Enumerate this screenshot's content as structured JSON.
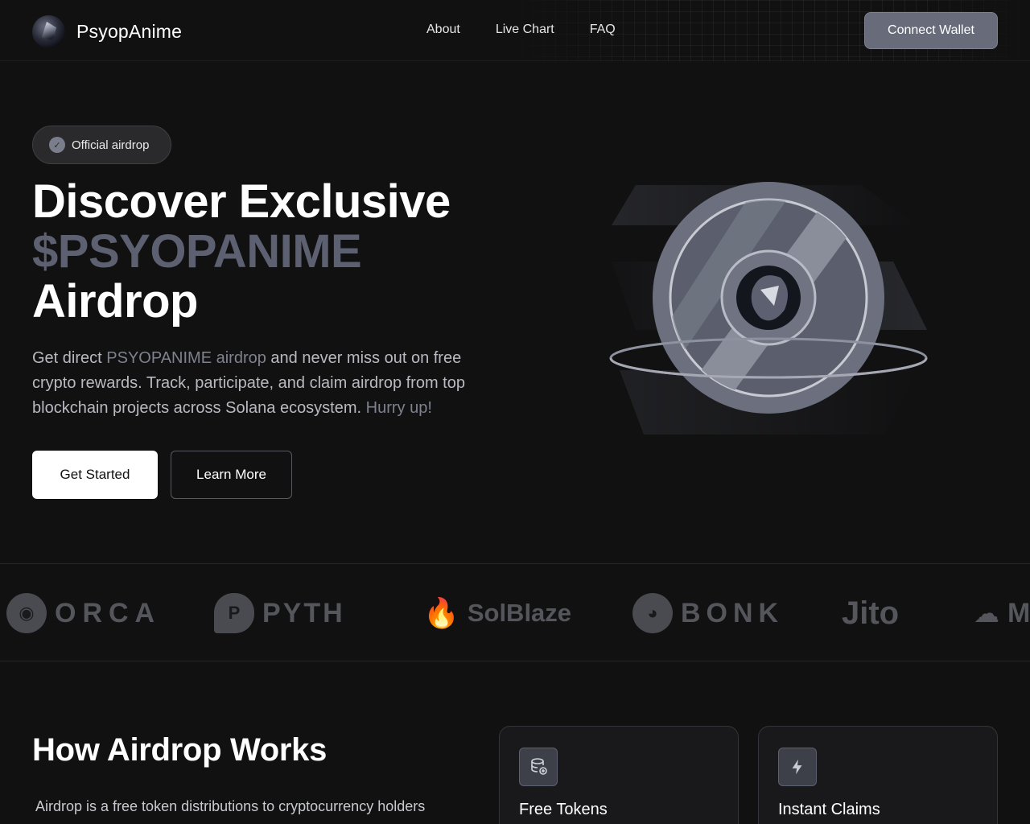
{
  "nav": {
    "brand": "PsyopAnime",
    "links": [
      "About",
      "Live Chart",
      "FAQ"
    ],
    "connect_label": "Connect Wallet"
  },
  "hero": {
    "badge": "Official airdrop",
    "title_line1": "Discover Exclusive",
    "title_line2": "$PSYOPANIME",
    "title_line3": "Airdrop",
    "desc_part1": "Get direct ",
    "desc_highlight": "PSYOPANIME airdrop",
    "desc_part2": " and never miss out on free crypto rewards. Track, participate, and claim airdrop from top blockchain projects across Solana ecosystem. ",
    "desc_hurry": "Hurry up!",
    "primary_cta": "Get Started",
    "secondary_cta": "Learn More"
  },
  "partners": [
    "ORCA",
    "PYTH",
    "SolBlaze",
    "BONK",
    "Jito",
    "M"
  ],
  "how": {
    "title": "How Airdrop Works",
    "desc": "Airdrop is a free token distributions to cryptocurrency holders",
    "cards": [
      {
        "title": "Free Tokens",
        "icon": "database-icon"
      },
      {
        "title": "Instant Claims",
        "icon": "lightning-icon"
      }
    ]
  },
  "colors": {
    "background": "#111112",
    "accent_gray": "#5c6070",
    "connect_button": "#676b7a"
  }
}
